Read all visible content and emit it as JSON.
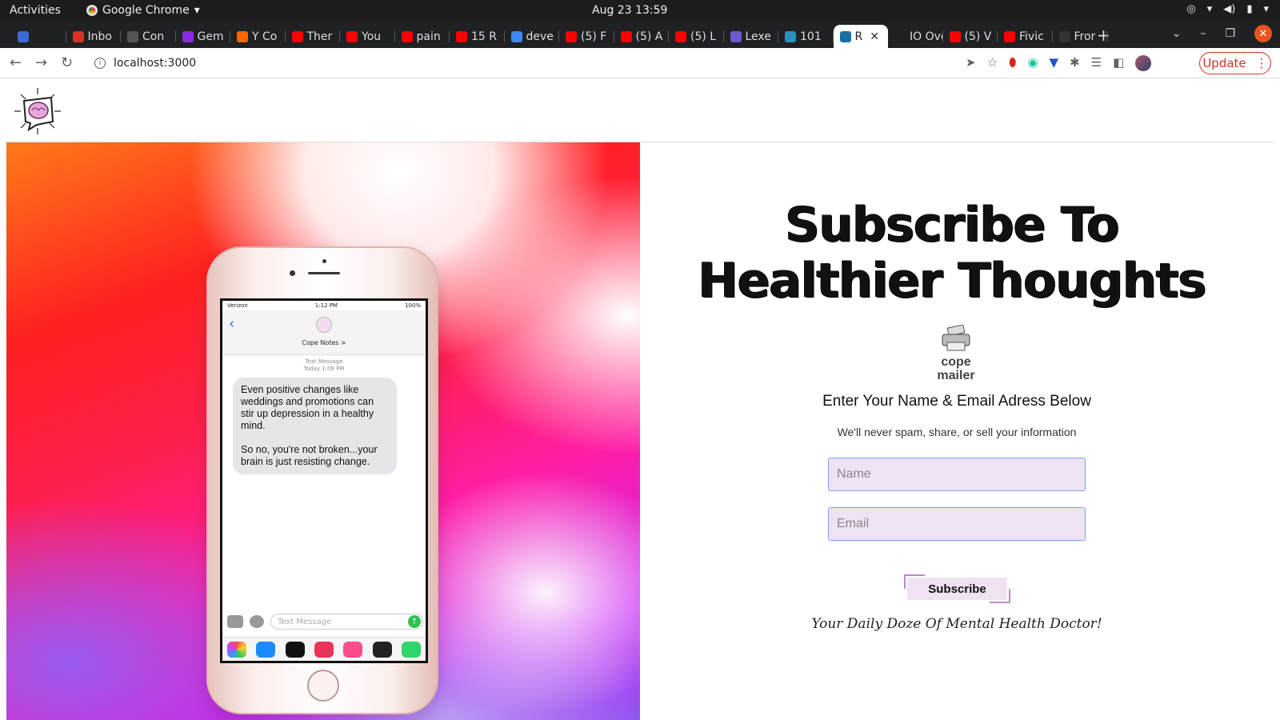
{
  "system": {
    "activities": "Activities",
    "app_name": "Google Chrome",
    "clock": "Aug 23  13:59"
  },
  "tabs": [
    {
      "label": "",
      "color": "#3b6ad8"
    },
    {
      "label": "Inbo",
      "color": "#d93025"
    },
    {
      "label": "Con",
      "color": "#555555"
    },
    {
      "label": "Gem",
      "color": "#8a2be2"
    },
    {
      "label": "Y Co",
      "color": "#ff6600"
    },
    {
      "label": "Ther",
      "color": "#ff0000"
    },
    {
      "label": "You",
      "color": "#ff0000"
    },
    {
      "label": "pain",
      "color": "#ff0000"
    },
    {
      "label": "15 R",
      "color": "#ff0000"
    },
    {
      "label": "deve",
      "color": "#4285f4"
    },
    {
      "label": "(5) F",
      "color": "#ff0000"
    },
    {
      "label": "(5) A",
      "color": "#ff0000"
    },
    {
      "label": "(5) L",
      "color": "#ff0000"
    },
    {
      "label": "Lexe",
      "color": "#6a5acd"
    },
    {
      "label": "101",
      "color": "#2a8fbd"
    },
    {
      "label": "R",
      "color": "#1a6fa0",
      "active": true
    },
    {
      "label": "IO Ove",
      "color": "#202124"
    },
    {
      "label": "(5) V",
      "color": "#ff0000"
    },
    {
      "label": "Fivic",
      "color": "#ff0000"
    },
    {
      "label": "Fror",
      "color": "#333333"
    }
  ],
  "address": {
    "url": "localhost:3000",
    "update_label": "Update"
  },
  "phone": {
    "carrier": "Verizon",
    "time": "1:12 PM",
    "battery": "100%",
    "contact": "Cope Notes >",
    "meta_line1": "Text Message",
    "meta_line2": "Today 1:09 PM",
    "message": "Even positive changes like weddings and promotions can stir up depression in a healthy mind.\n\nSo no, you're not broken...your brain is just resisting change.",
    "input_placeholder": "Text Message"
  },
  "signup": {
    "headline": "Subscribe To Healthier Thoughts",
    "logo_line1": "cope",
    "logo_line2": "mailer",
    "form_title": "Enter Your Name & Email Adress Below",
    "privacy": "We'll never spam, share, or sell your information",
    "name_placeholder": "Name",
    "email_placeholder": "Email",
    "subscribe_label": "Subscribe",
    "tagline": "Your Daily Doze Of Mental Health Doctor!"
  }
}
